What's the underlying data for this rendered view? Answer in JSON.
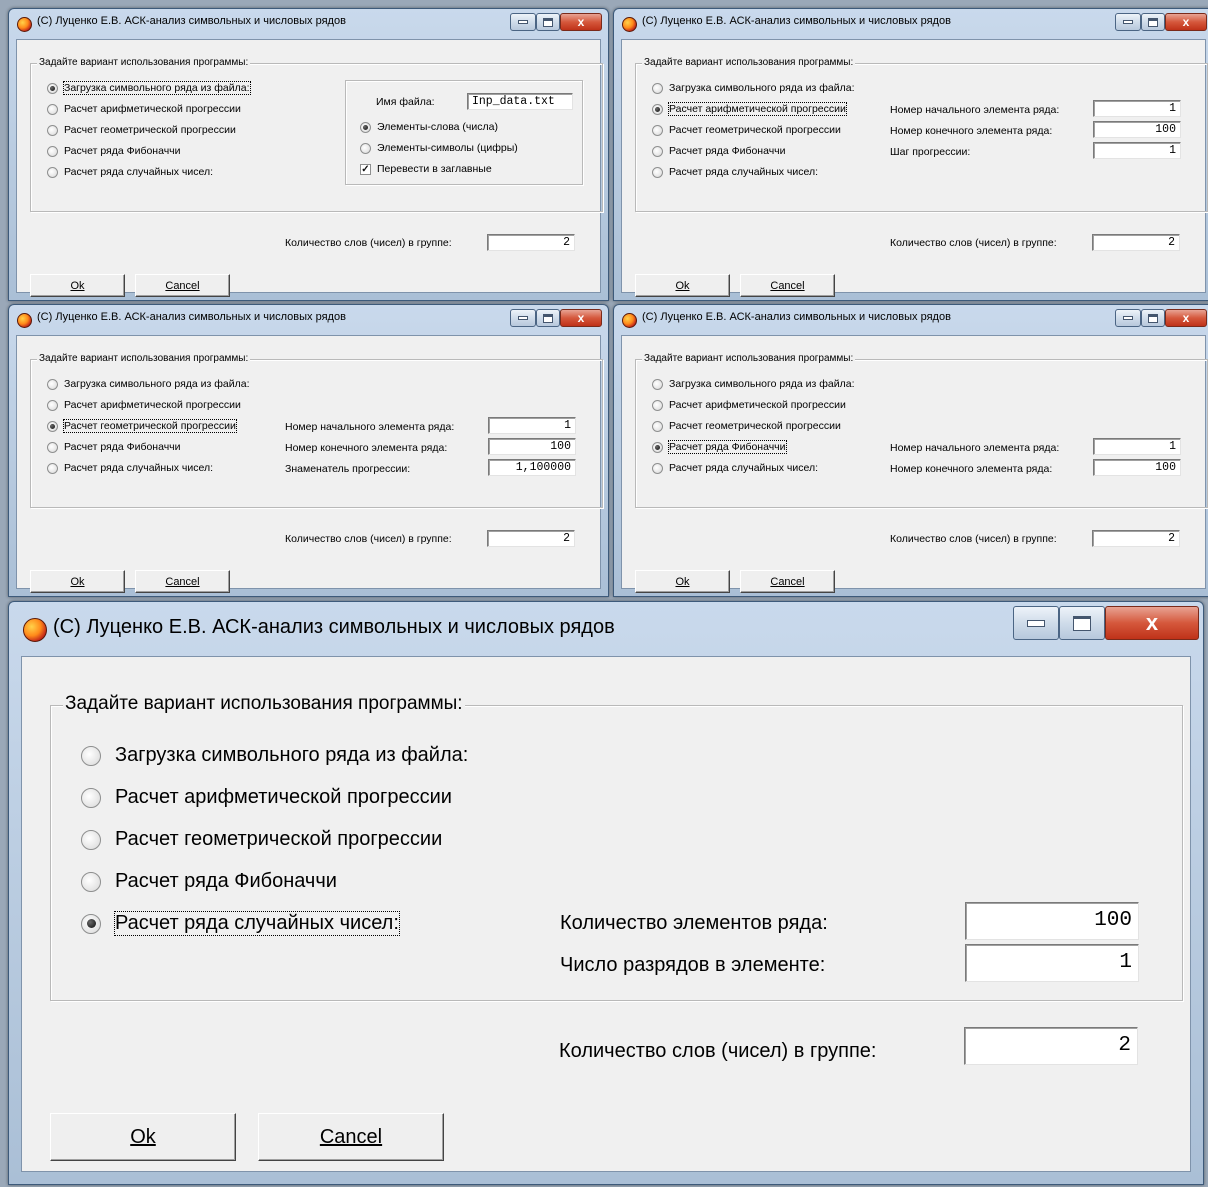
{
  "window_title": "(С) Луценко Е.В. АСК-анализ символьных и числовых рядов",
  "group_title": "Задайте вариант использования программы:",
  "options": [
    "Загрузка символьного ряда из файла:",
    "Расчет арифметической прогрессии",
    "Расчет геометрической прогрессии",
    "Расчет ряда Фибоначчи",
    "Расчет ряда случайных чисел:"
  ],
  "buttons": {
    "ok": "Ok",
    "cancel": "Cancel",
    "close_glyph": "x"
  },
  "words_in_group_label": "Количество слов (чисел) в группе:",
  "words_in_group_value": "2",
  "file_panel": {
    "file_name_label": "Имя файла:",
    "file_name_value": "Inp_data.txt",
    "words_option": "Элементы-слова (числа)",
    "symbols_option": "Элементы-символы (цифры)",
    "uppercase_option": "Перевести в заглавные",
    "check_glyph": "✓"
  },
  "arithmetic_panel": {
    "start_label": "Номер начального элемента ряда:",
    "start_value": "1",
    "end_label": "Номер конечного  элемента ряда:",
    "end_value": "100",
    "step_label": "Шаг прогрессии:",
    "step_value": "1"
  },
  "geometric_panel": {
    "start_label": "Номер начального элемента ряда:",
    "start_value": "1",
    "end_label": "Номер конечного  элемента ряда:",
    "end_value": "100",
    "ratio_label": "Знаменатель прогрессии:",
    "ratio_value": "1,100000"
  },
  "fibonacci_panel": {
    "start_label": "Номер начального элемента ряда:",
    "start_value": "1",
    "end_label": "Номер конечного  элемента ряда:",
    "end_value": "100"
  },
  "random_panel": {
    "count_label": "Количество элементов ряда:",
    "count_value": "100",
    "digits_label": "Число разрядов в элементе:",
    "digits_value": "1"
  }
}
